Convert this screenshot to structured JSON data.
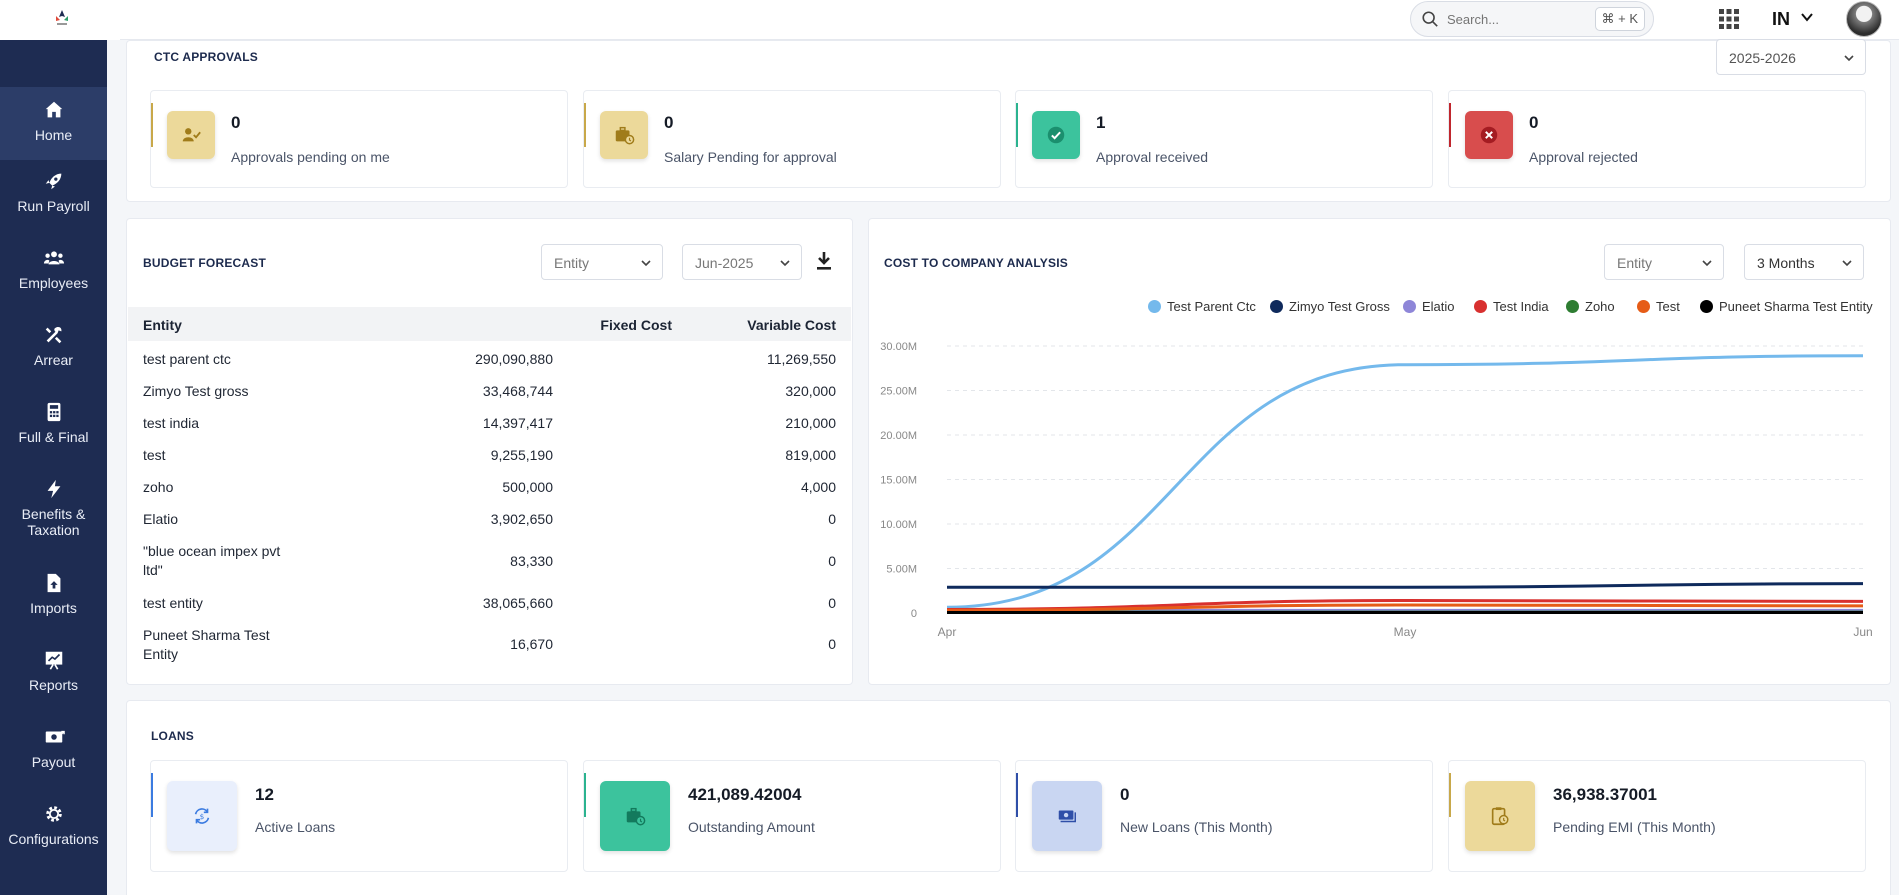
{
  "header": {
    "search_placeholder": "Search...",
    "shortcut": "⌘ + K",
    "country": "IN"
  },
  "sidebar": {
    "items": [
      {
        "label": "Home",
        "icon": "home-icon",
        "active": true
      },
      {
        "label": "Run Payroll",
        "icon": "rocket-icon"
      },
      {
        "label": "Employees",
        "icon": "users-icon"
      },
      {
        "label": "Arrear",
        "icon": "tools-icon"
      },
      {
        "label": "Full & Final",
        "icon": "calculator-icon"
      },
      {
        "label": "Benefits & Taxation",
        "icon": "bolt-icon"
      },
      {
        "label": "Imports",
        "icon": "file-upload-icon"
      },
      {
        "label": "Reports",
        "icon": "chart-board-icon"
      },
      {
        "label": "Payout",
        "icon": "money-icon"
      },
      {
        "label": "Configurations",
        "icon": "gear-icon"
      }
    ]
  },
  "ctc": {
    "title": "CTC APPROVALS",
    "year": "2025-2026",
    "stats": [
      {
        "value": "0",
        "label": "Approvals pending on me",
        "accent": "#c8a84a",
        "icon_bg": "#ecd99a",
        "icon": "user-check-icon"
      },
      {
        "value": "0",
        "label": "Salary Pending for approval",
        "accent": "#c8a84a",
        "icon_bg": "#ecd99a",
        "icon": "briefcase-clock-icon"
      },
      {
        "value": "1",
        "label": "Approval received",
        "accent": "#2bb38f",
        "icon_bg": "#3cc39d",
        "icon": "check-circle-icon"
      },
      {
        "value": "0",
        "label": "Approval rejected",
        "accent": "#c0262d",
        "icon_bg": "#d84d4d",
        "icon": "x-circle-icon"
      }
    ]
  },
  "budget": {
    "title": "BUDGET FORECAST",
    "entity_placeholder": "Entity",
    "month": "Jun-2025",
    "columns": [
      "Entity",
      "Fixed Cost",
      "Variable Cost"
    ],
    "rows": [
      [
        "test parent ctc",
        "290,090,880",
        "11,269,550"
      ],
      [
        "Zimyo Test gross",
        "33,468,744",
        "320,000"
      ],
      [
        "test india",
        "14,397,417",
        "210,000"
      ],
      [
        "test",
        "9,255,190",
        "819,000"
      ],
      [
        "zoho",
        "500,000",
        "4,000"
      ],
      [
        "Elatio",
        "3,902,650",
        "0"
      ],
      [
        "\"blue ocean impex pvt ltd\"",
        "83,330",
        "0"
      ],
      [
        "test entity",
        "38,065,660",
        "0"
      ],
      [
        "Puneet Sharma Test Entity",
        "16,670",
        "0"
      ]
    ]
  },
  "ctc_analysis": {
    "title": "COST TO COMPANY ANALYSIS",
    "entity_placeholder": "Entity",
    "period": "3 Months"
  },
  "chart_data": {
    "type": "line",
    "x": [
      "Apr",
      "May",
      "Jun"
    ],
    "ylim": [
      0,
      30000000
    ],
    "yticks": [
      "0",
      "5.00M",
      "10.00M",
      "15.00M",
      "20.00M",
      "25.00M",
      "30.00M"
    ],
    "grid": true,
    "legend_position": "top-right",
    "series": [
      {
        "name": "Test Parent Ctc",
        "color": "#74b9ec",
        "values": [
          650000,
          27900000,
          28900000
        ]
      },
      {
        "name": "Zimyo Test Gross",
        "color": "#0f2a5c",
        "values": [
          2900000,
          2900000,
          3300000
        ]
      },
      {
        "name": "Elatio",
        "color": "#8e86d8",
        "values": [
          300000,
          300000,
          300000
        ]
      },
      {
        "name": "Test India",
        "color": "#d8302f",
        "values": [
          400000,
          1400000,
          1300000
        ]
      },
      {
        "name": "Zoho",
        "color": "#2e7d32",
        "values": [
          100000,
          100000,
          100000
        ]
      },
      {
        "name": "Test",
        "color": "#e65c17",
        "values": [
          300000,
          900000,
          800000
        ]
      },
      {
        "name": "Puneet Sharma Test Entity",
        "color": "#000000",
        "values": [
          50000,
          50000,
          50000
        ]
      }
    ]
  },
  "loans": {
    "title": "LOANS",
    "stats": [
      {
        "value": "12",
        "label": "Active Loans",
        "accent": "#3b7be0",
        "icon_bg": "#e9effc",
        "icon": "refresh-dollar-icon"
      },
      {
        "value": "421,089.42004",
        "label": "Outstanding Amount",
        "accent": "#2bb38f",
        "icon_bg": "#3cc39d",
        "icon": "briefcase-clock-icon"
      },
      {
        "value": "0",
        "label": "New Loans (This Month)",
        "accent": "#2f4fa8",
        "icon_bg": "#c9d6f2",
        "icon": "money-stack-icon"
      },
      {
        "value": "36,938.37001",
        "label": "Pending EMI (This Month)",
        "accent": "#c8a84a",
        "icon_bg": "#ecd99a",
        "icon": "clipboard-clock-icon"
      }
    ]
  }
}
